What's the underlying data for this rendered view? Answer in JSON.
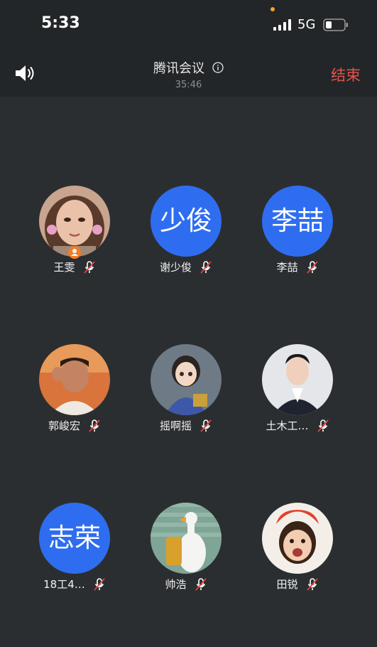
{
  "status_bar": {
    "time": "5:33",
    "network": "5G"
  },
  "header": {
    "title": "腾讯会议",
    "timer": "35:46",
    "end_label": "结束"
  },
  "participants": [
    {
      "name": "王雯",
      "avatar_text": "",
      "avatar_kind": "photo",
      "muted": true,
      "host": true
    },
    {
      "name": "谢少俊",
      "avatar_text": "少俊",
      "avatar_kind": "text",
      "muted": true,
      "host": false
    },
    {
      "name": "李喆",
      "avatar_text": "李喆",
      "avatar_kind": "text",
      "muted": true,
      "host": false
    },
    {
      "name": "郭峻宏",
      "avatar_text": "",
      "avatar_kind": "photo",
      "muted": true,
      "host": false
    },
    {
      "name": "摇啊摇",
      "avatar_text": "",
      "avatar_kind": "photo",
      "muted": true,
      "host": false
    },
    {
      "name": "土木工…",
      "avatar_text": "",
      "avatar_kind": "photo",
      "muted": true,
      "host": false
    },
    {
      "name": "18工4…",
      "avatar_text": "志荣",
      "avatar_kind": "text",
      "muted": true,
      "host": false
    },
    {
      "name": "帅浩",
      "avatar_text": "",
      "avatar_kind": "photo",
      "muted": true,
      "host": false
    },
    {
      "name": "田锐",
      "avatar_text": "",
      "avatar_kind": "photo",
      "muted": true,
      "host": false
    }
  ],
  "colors": {
    "background": "#2b2e31",
    "bar": "#232628",
    "accent_blue": "#2f6df0",
    "end_red": "#e5534b",
    "muted_red": "#e0453c",
    "host_orange": "#f07d2a"
  }
}
